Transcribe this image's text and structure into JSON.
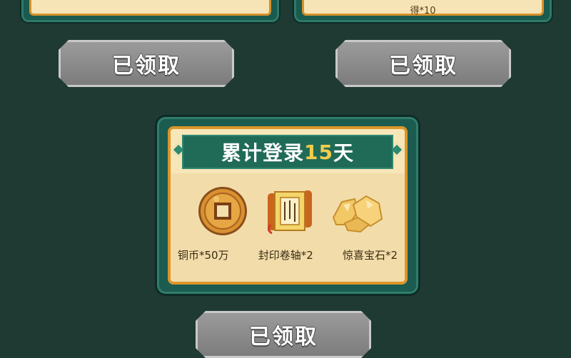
{
  "top_cards": {
    "right_fragment_text": "得*10"
  },
  "buttons": {
    "claimed_label": "已领取"
  },
  "reward_card": {
    "title_prefix": "累计登录",
    "title_days": "15",
    "title_suffix": "天",
    "items": [
      {
        "icon": "copper-coin-icon",
        "label": "铜币*50万"
      },
      {
        "icon": "seal-scroll-icon",
        "label": "封印卷轴*2"
      },
      {
        "icon": "surprise-gem-icon",
        "label": "惊喜宝石*2"
      }
    ]
  },
  "colors": {
    "background": "#1f3a33",
    "card_frame": "#1c5b50",
    "panel": "#f7e6b8",
    "panel_border": "#dc952a",
    "title_banner": "#1f6b58",
    "title_highlight": "#f3cd4a",
    "claimed_button": "#8a8a8a"
  }
}
